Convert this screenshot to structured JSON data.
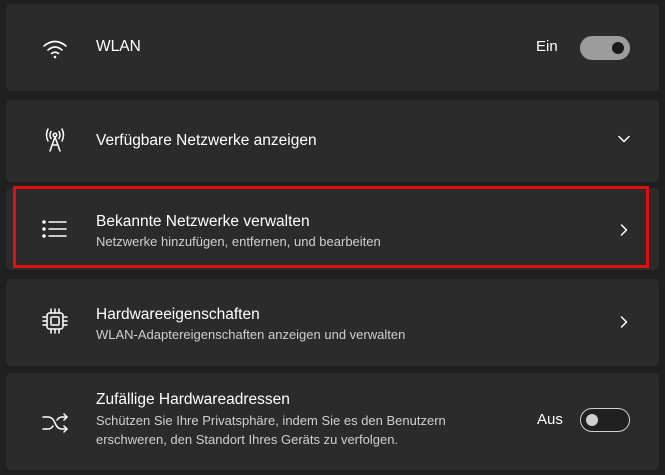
{
  "wlan": {
    "title": "WLAN",
    "state_label": "Ein",
    "icon": "wifi-icon",
    "toggle_on": true
  },
  "available_networks": {
    "title": "Verfügbare Netzwerke anzeigen",
    "icon": "antenna-icon"
  },
  "known_networks": {
    "title": "Bekannte Netzwerke verwalten",
    "subtitle": "Netzwerke hinzufügen, entfernen, und bearbeiten",
    "icon": "list-icon"
  },
  "hardware_properties": {
    "title": "Hardwareeigenschaften",
    "subtitle": "WLAN-Adaptereigenschaften anzeigen und verwalten",
    "icon": "chip-icon"
  },
  "random_hardware_addresses": {
    "title": "Zufällige Hardwareadressen",
    "subtitle_line1": "Schützen Sie Ihre Privatsphäre, indem Sie es den Benutzern",
    "subtitle_line2": "erschweren, den Standort Ihres Geräts zu verfolgen.",
    "state_label": "Aus",
    "icon": "shuffle-icon",
    "toggle_on": false
  },
  "colors": {
    "background": "#202020",
    "card": "#2b2b2b",
    "highlight": "#e01010"
  }
}
